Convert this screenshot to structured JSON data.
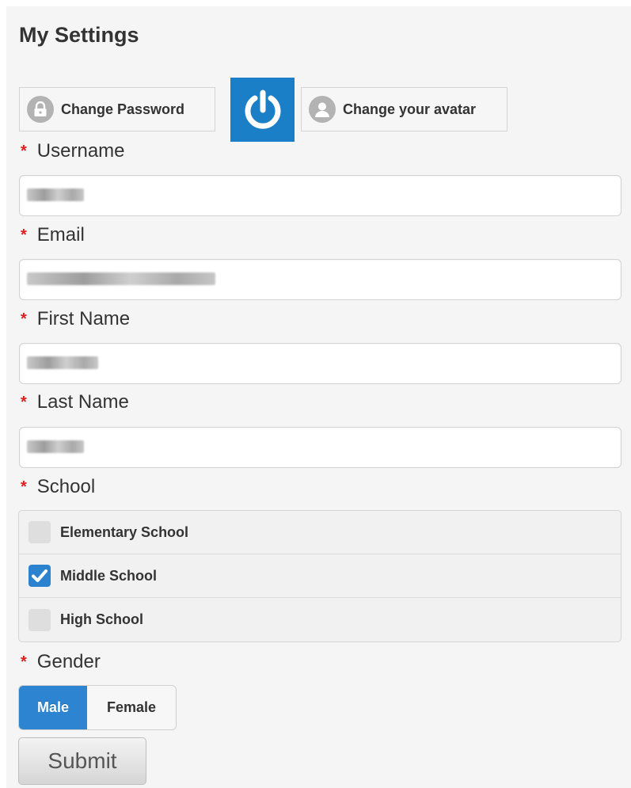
{
  "page": {
    "title": "My Settings"
  },
  "actions": {
    "change_password": "Change Password",
    "change_avatar": "Change your avatar"
  },
  "form": {
    "required_mark": "*",
    "username": {
      "label": "Username",
      "value": ""
    },
    "email": {
      "label": "Email",
      "value": ""
    },
    "first_name": {
      "label": "First Name",
      "value": ""
    },
    "last_name": {
      "label": "Last Name",
      "value": ""
    },
    "school": {
      "label": "School",
      "options": [
        {
          "label": "Elementary School",
          "checked": false
        },
        {
          "label": "Middle School",
          "checked": true
        },
        {
          "label": "High School",
          "checked": false
        }
      ]
    },
    "gender": {
      "label": "Gender",
      "options": [
        "Male",
        "Female"
      ],
      "selected": "Male"
    },
    "submit_label": "Submit"
  },
  "colors": {
    "accent": "#2d85d1",
    "power_button": "#1a7fc6",
    "required": "#e01e1e"
  },
  "icons": {
    "password": "lock-icon",
    "power": "power-icon",
    "avatar": "user-icon",
    "checkbox": "checkmark-icon"
  }
}
